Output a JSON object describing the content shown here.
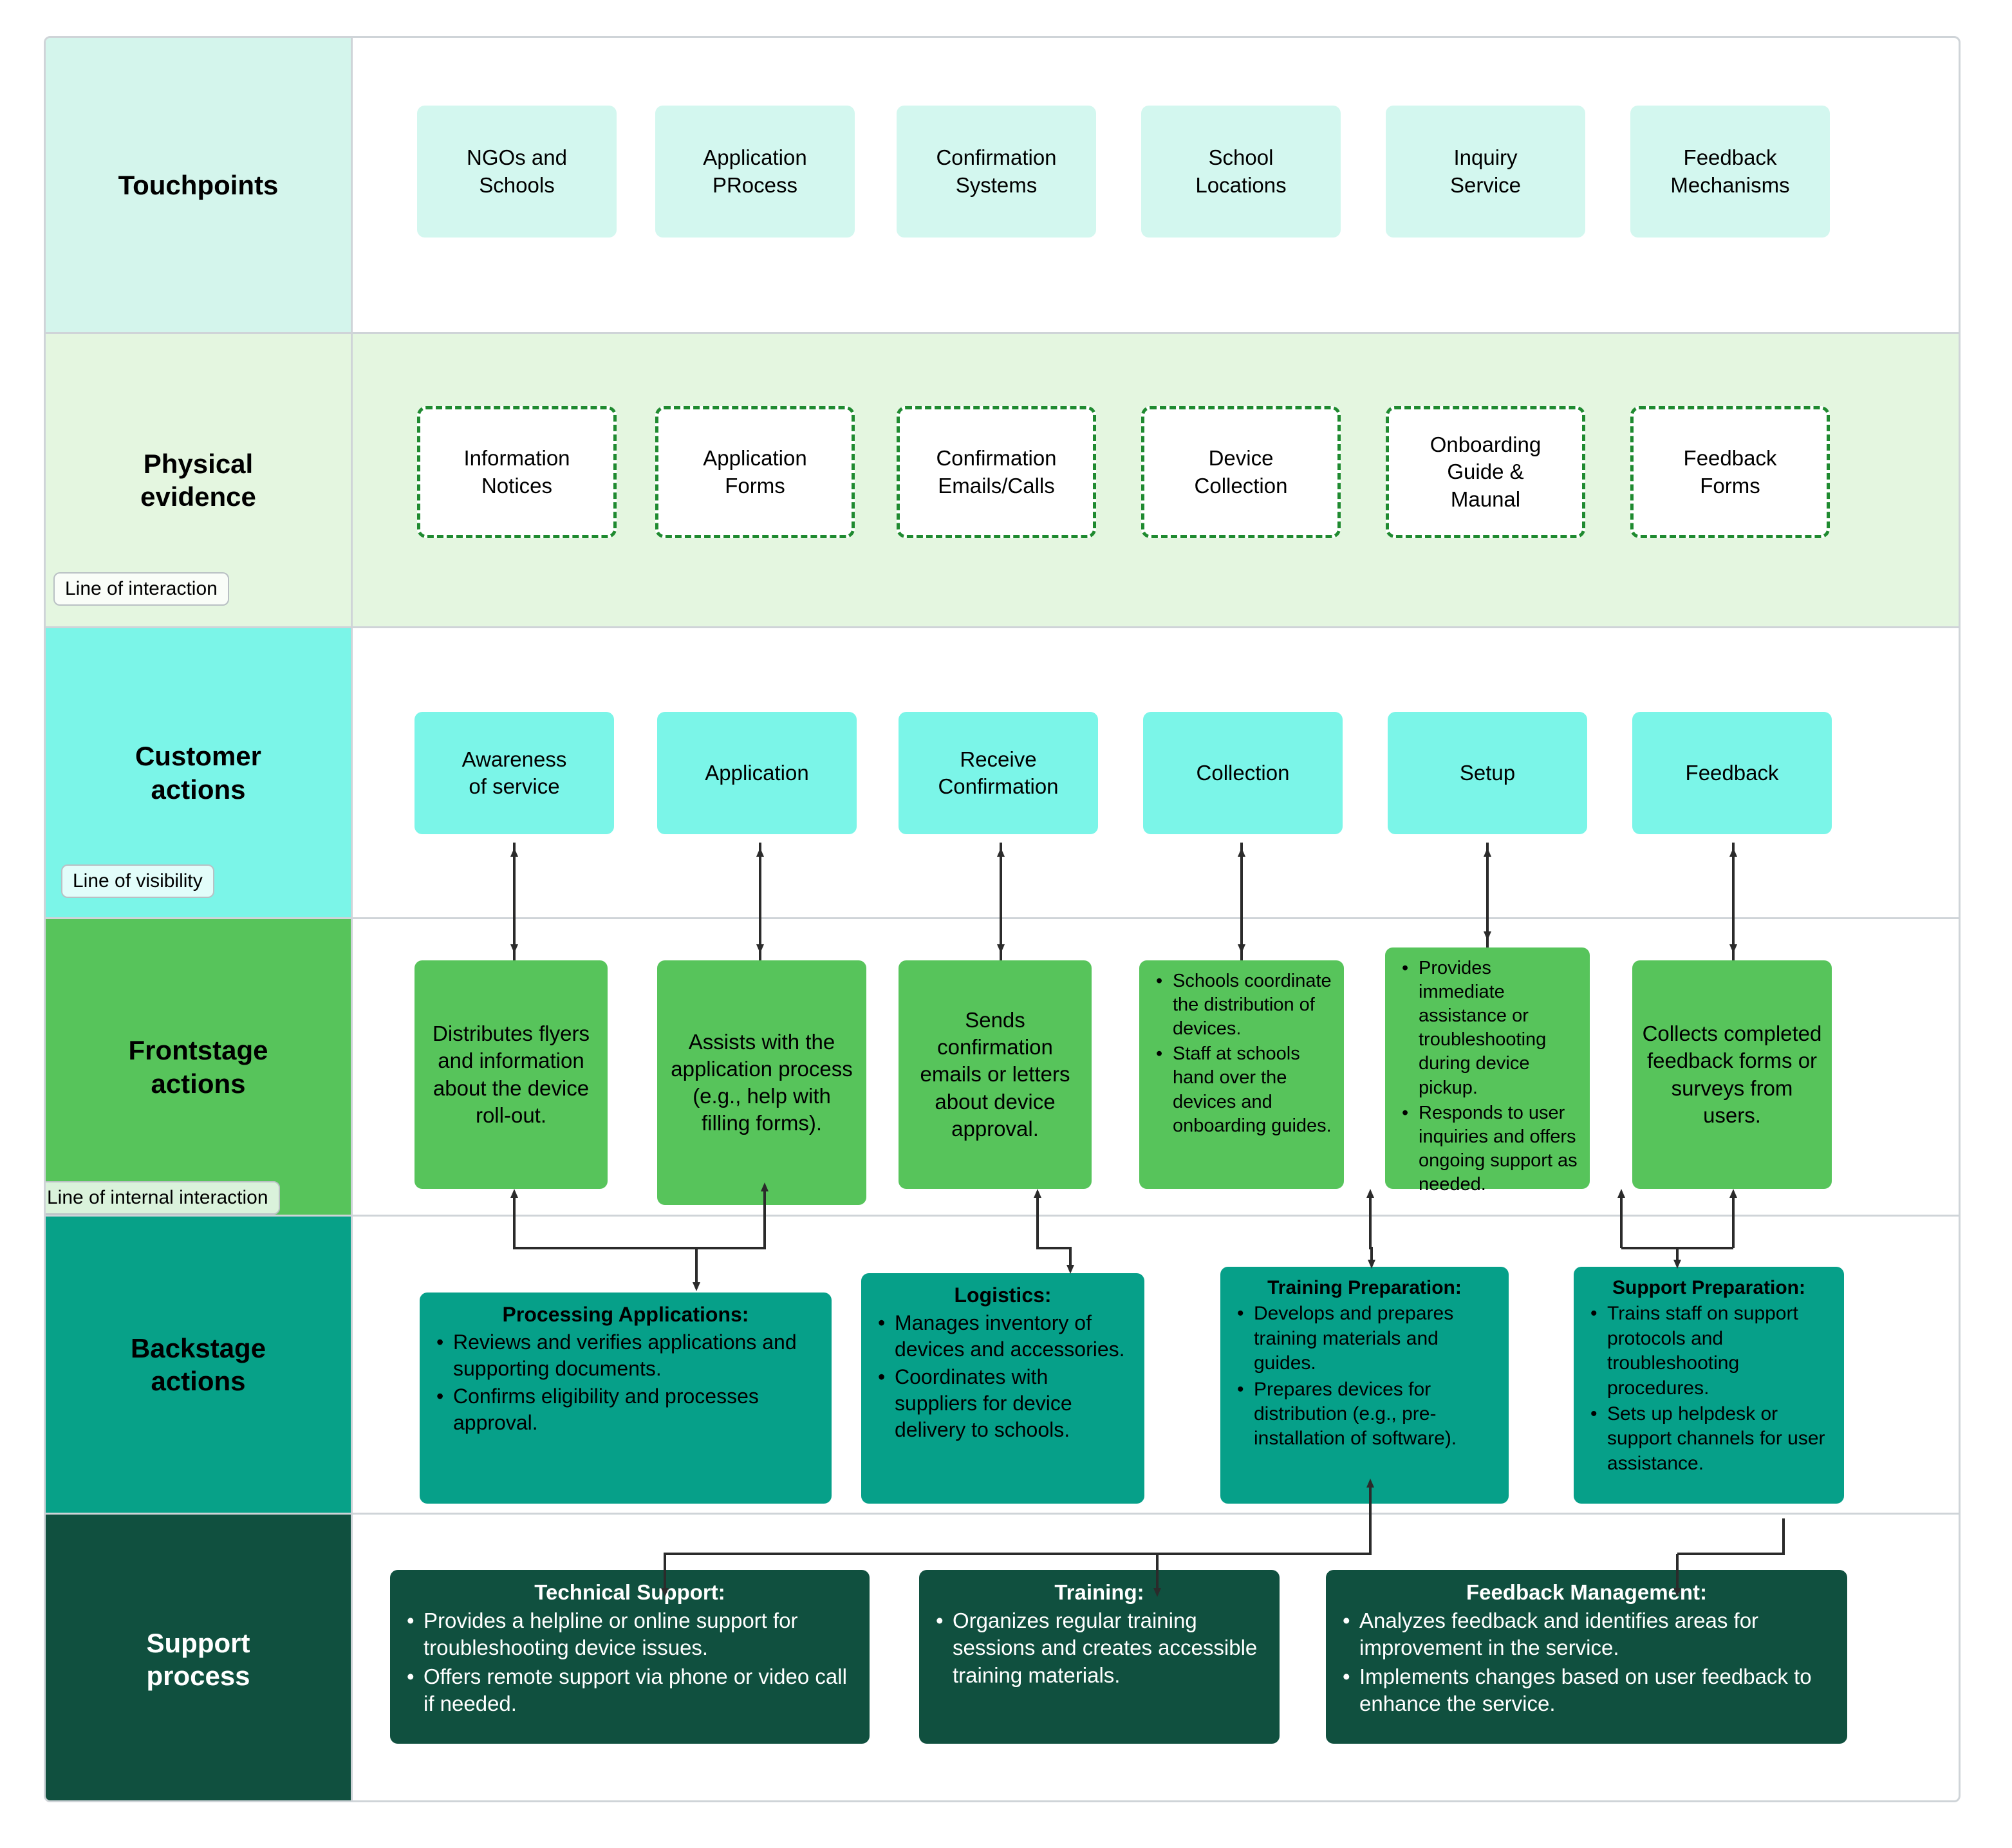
{
  "colors": {
    "touchpoints_band": "#d4f5ec",
    "physical_band": "#e4f6e0",
    "customer_band": "#7bf5e8",
    "frontstage_band": "#57c45b",
    "backstage_band": "#07a188",
    "support_band": "#10503f",
    "dashed_border": "#1f8a30",
    "grid_line": "#cfd4d8"
  },
  "rows": [
    {
      "key": "touchpoints",
      "label": "Touchpoints"
    },
    {
      "key": "physical",
      "label": "Physical\nevidence"
    },
    {
      "key": "customer",
      "label": "Customer\nactions"
    },
    {
      "key": "frontstage",
      "label": "Frontstage\nactions"
    },
    {
      "key": "backstage",
      "label": "Backstage\nactions"
    },
    {
      "key": "support",
      "label": "Support\nprocess"
    }
  ],
  "row_labels": {
    "touchpoints": "Touchpoints",
    "physical_l1": "Physical",
    "physical_l2": "evidence",
    "customer_l1": "Customer",
    "customer_l2": "actions",
    "frontstage_l1": "Frontstage",
    "frontstage_l2": "actions",
    "backstage_l1": "Backstage",
    "backstage_l2": "actions",
    "support_l1": "Support",
    "support_l2": "process"
  },
  "separators": {
    "line_of_interaction": "Line of interaction",
    "line_of_visibility": "Line of visibility",
    "line_of_internal_interaction": "Line of internal interaction"
  },
  "touchpoints": [
    {
      "l1": "NGOs and",
      "l2": "Schools"
    },
    {
      "l1": "Application",
      "l2": "PRocess"
    },
    {
      "l1": "Confirmation",
      "l2": "Systems"
    },
    {
      "l1": "School",
      "l2": "Locations"
    },
    {
      "l1": "Inquiry",
      "l2": "Service"
    },
    {
      "l1": "Feedback",
      "l2": "Mechanisms"
    }
  ],
  "physical_evidence": [
    {
      "l1": "Information",
      "l2": "Notices",
      "l3": ""
    },
    {
      "l1": "Application",
      "l2": "Forms",
      "l3": ""
    },
    {
      "l1": "Confirmation",
      "l2": "Emails/Calls",
      "l3": ""
    },
    {
      "l1": "Device",
      "l2": "Collection",
      "l3": ""
    },
    {
      "l1": "Onboarding",
      "l2": "Guide &",
      "l3": "Maunal"
    },
    {
      "l1": "Feedback",
      "l2": "Forms",
      "l3": ""
    }
  ],
  "customer_actions": [
    {
      "l1": "Awareness",
      "l2": "of service"
    },
    {
      "l1": "Application",
      "l2": ""
    },
    {
      "l1": "Receive",
      "l2": "Confirmation"
    },
    {
      "l1": "Collection",
      "l2": ""
    },
    {
      "l1": "Setup",
      "l2": ""
    },
    {
      "l1": "Feedback",
      "l2": ""
    }
  ],
  "frontstage_actions": [
    {
      "kind": "text",
      "text": "Distributes flyers and information about the device roll-out."
    },
    {
      "kind": "text",
      "text": "Assists with the application process (e.g., help with filling forms)."
    },
    {
      "kind": "text",
      "text": "Sends confirmation emails or letters about device approval."
    },
    {
      "kind": "list",
      "header": "",
      "bullets": [
        "Schools coordinate the distribution of devices.",
        "Staff at schools hand over the devices and onboarding guides."
      ]
    },
    {
      "kind": "list",
      "header": "",
      "bullets": [
        "Provides immediate assistance or troubleshooting during device pickup.",
        "Responds to user inquiries and offers ongoing support as needed."
      ]
    },
    {
      "kind": "text",
      "text": "Collects completed feedback forms or surveys from users."
    }
  ],
  "backstage_actions": [
    {
      "header": "Processing Applications:",
      "bullets": [
        "Reviews and verifies applications and supporting documents.",
        "Confirms eligibility and processes approval."
      ]
    },
    {
      "header": "Logistics:",
      "bullets": [
        "Manages inventory of devices and accessories.",
        "Coordinates with suppliers for device delivery to schools."
      ]
    },
    {
      "header": "Training Preparation:",
      "bullets": [
        "Develops and prepares training materials and guides.",
        "Prepares devices for distribution (e.g., pre-installation of software)."
      ]
    },
    {
      "header": "Support Preparation:",
      "bullets": [
        "Trains staff on support protocols and troubleshooting procedures.",
        "Sets up helpdesk or support channels for user assistance."
      ]
    }
  ],
  "support_process": [
    {
      "header": "Technical Support:",
      "bullets": [
        "Provides a helpline or online support for troubleshooting device issues.",
        "Offers remote support via phone or video call if needed."
      ]
    },
    {
      "header": "Training:",
      "bullets": [
        "Organizes regular training sessions and creates accessible training materials."
      ]
    },
    {
      "header": "Feedback Management:",
      "bullets": [
        "Analyzes feedback and identifies areas for improvement in the service.",
        "Implements changes based on user feedback to enhance the service."
      ]
    }
  ]
}
